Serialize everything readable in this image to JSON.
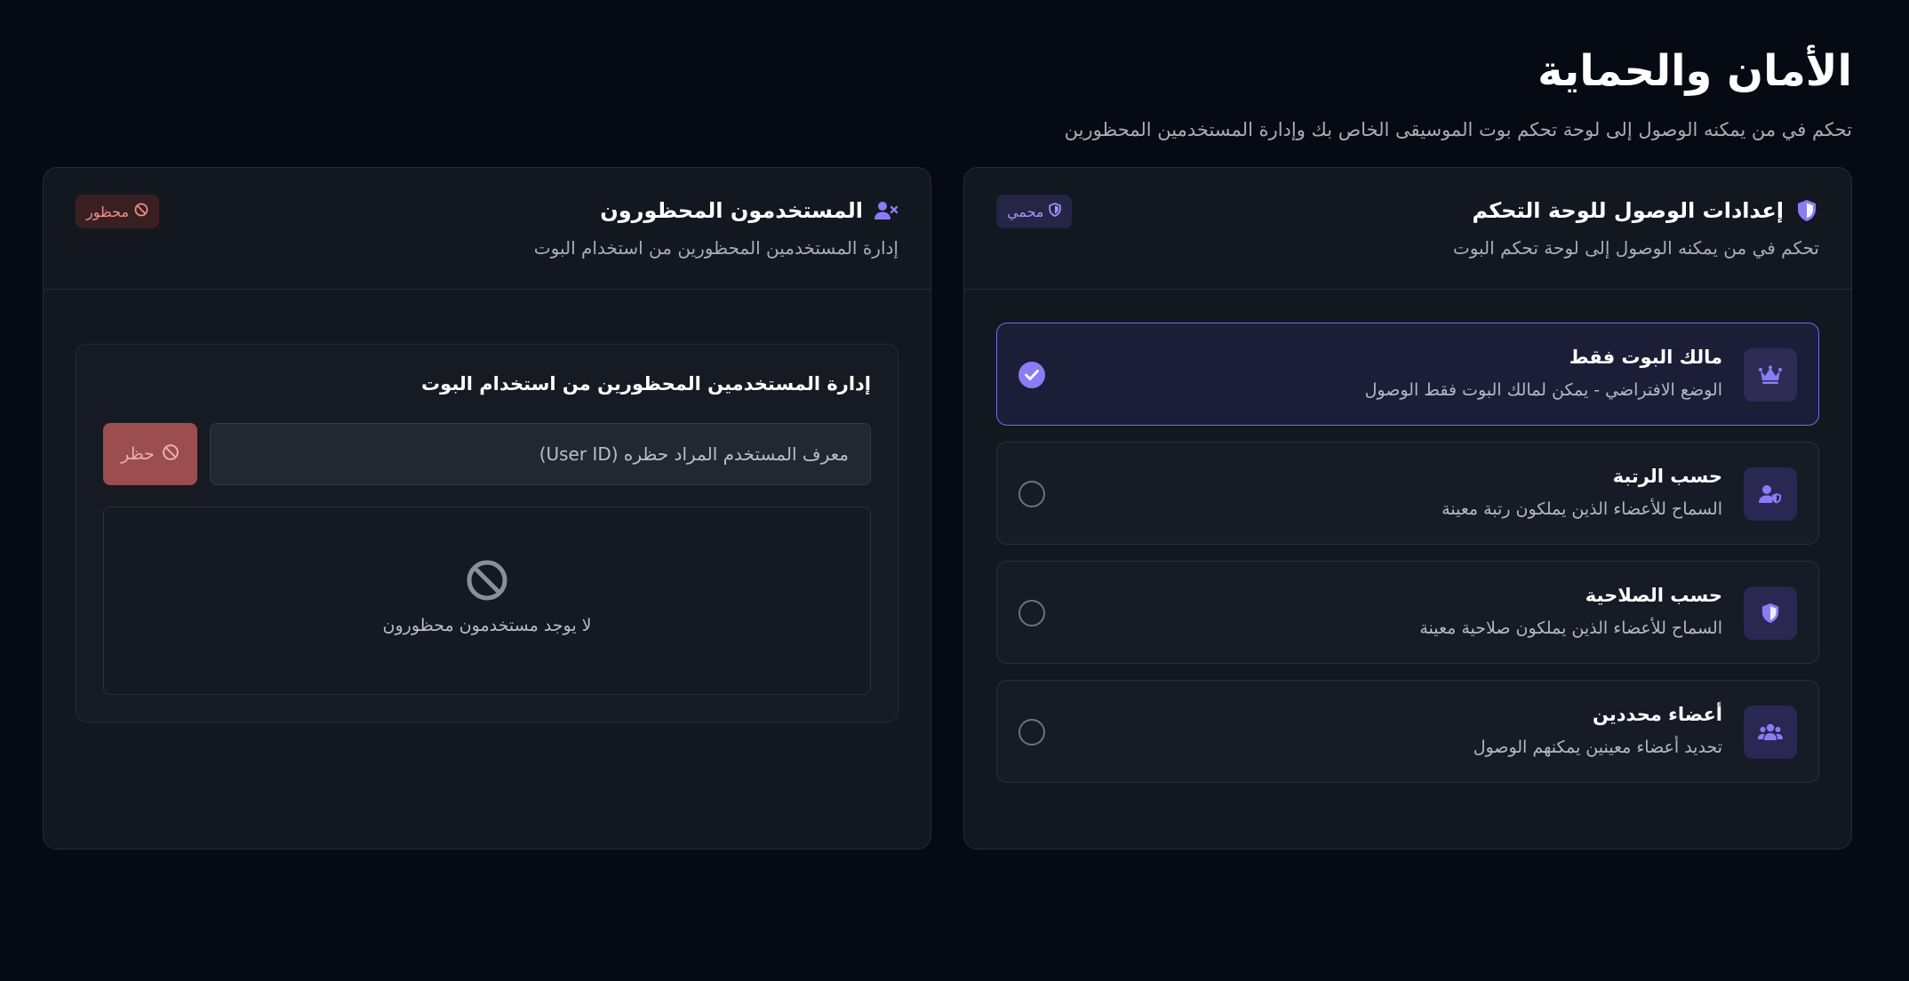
{
  "header": {
    "title": "الأمان والحماية",
    "subtitle": "تحكم في من يمكنه الوصول إلى لوحة تحكم بوت الموسيقى الخاص بك وإدارة المستخدمين المحظورين"
  },
  "access_card": {
    "title": "إعدادات الوصول للوحة التحكم",
    "description": "تحكم في من يمكنه الوصول إلى لوحة تحكم البوت",
    "badge": "محمي",
    "options": [
      {
        "icon": "crown-icon",
        "title": "مالك البوت فقط",
        "description": "الوضع الافتراضي - يمكن لمالك البوت فقط الوصول",
        "selected": true
      },
      {
        "icon": "user-shield-icon",
        "title": "حسب الرتبة",
        "description": "السماح للأعضاء الذين يملكون رتبة معينة",
        "selected": false
      },
      {
        "icon": "shield-icon",
        "title": "حسب الصلاحية",
        "description": "السماح للأعضاء الذين يملكون صلاحية معينة",
        "selected": false
      },
      {
        "icon": "users-icon",
        "title": "أعضاء محددين",
        "description": "تحديد أعضاء معينين يمكنهم الوصول",
        "selected": false
      }
    ]
  },
  "banned_card": {
    "title": "المستخدمون المحظورون",
    "description": "إدارة المستخدمين المحظورين من استخدام البوت",
    "badge": "محظور",
    "panel_title": "إدارة المستخدمين المحظورين من استخدام البوت",
    "input_placeholder": "معرف المستخدم المراد حظره (User ID)",
    "input_value": "",
    "ban_button": "حظر",
    "empty_text": "لا يوجد مستخدمون محظورون"
  },
  "colors": {
    "background": "#060a13",
    "card": "#131720",
    "accent": "#8b7cf6",
    "danger": "#9c4d4f"
  }
}
